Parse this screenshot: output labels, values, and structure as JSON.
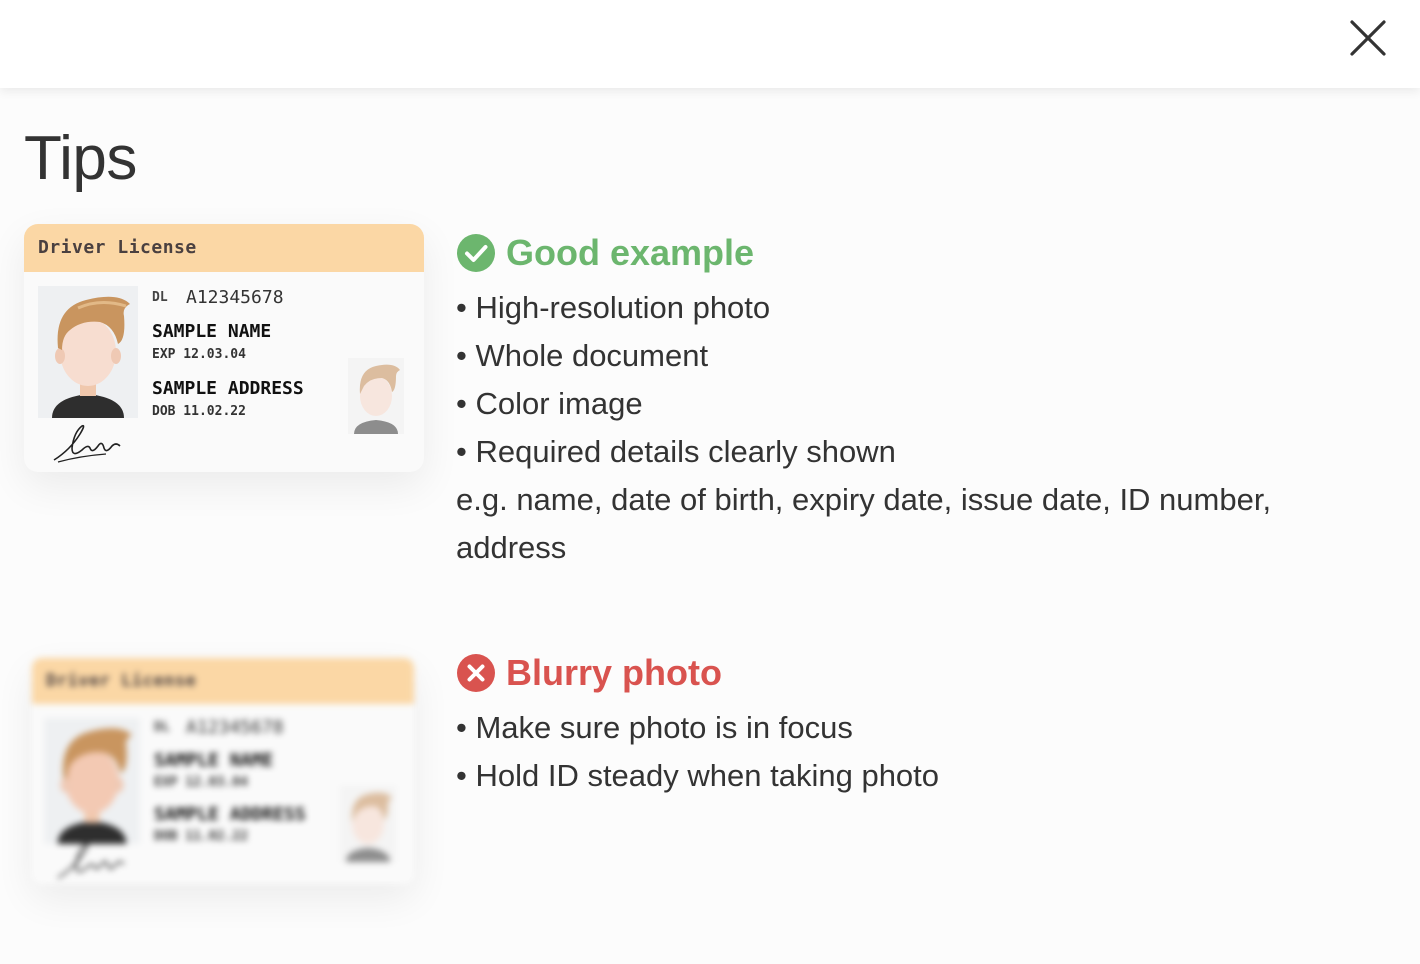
{
  "header": {
    "close_icon": "close-icon"
  },
  "page": {
    "title": "Tips"
  },
  "sample_card": {
    "header": "Driver License",
    "dl_label": "DL",
    "dl_number": "A12345678",
    "name": "SAMPLE NAME",
    "exp": "EXP 12.03.04",
    "address": "SAMPLE ADDRESS",
    "dob": "DOB 11.02.22"
  },
  "tips": [
    {
      "icon": "check-circle-icon",
      "color": "#6cb66e",
      "title": "Good example",
      "items": [
        "• High-resolution photo",
        "• Whole document",
        "• Color image",
        "• Required details clearly shown"
      ],
      "note": "e.g. name, date of birth, expiry date, issue date, ID number, address"
    },
    {
      "icon": "x-circle-icon",
      "color": "#d9534f",
      "title": "Blurry photo",
      "items": [
        "• Make sure photo is in focus",
        "• Hold ID steady when taking photo"
      ]
    }
  ],
  "colors": {
    "card_header": "#fbd7a5",
    "good": "#6cb66e",
    "bad": "#d9534f",
    "text": "#333333"
  }
}
